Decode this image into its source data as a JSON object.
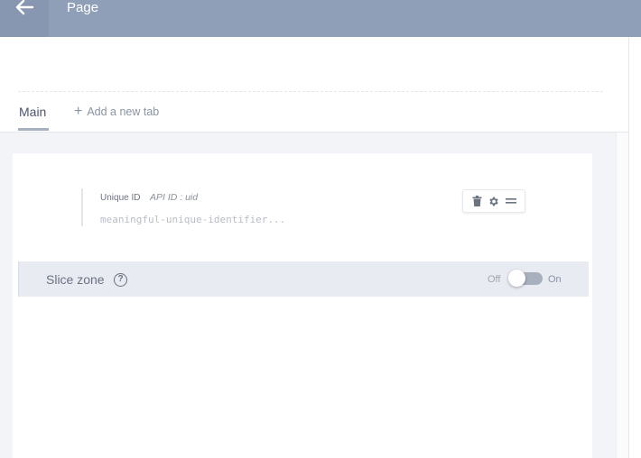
{
  "header": {
    "title": "Page",
    "back_icon": "arrow-left-icon"
  },
  "tabs": [
    {
      "label": "Main",
      "active": true
    }
  ],
  "add_tab": {
    "label": "Add a new tab",
    "icon": "plus-icon"
  },
  "uid_field": {
    "label": "Unique ID",
    "api_id": "API ID : uid",
    "placeholder": "meaningful-unique-identifier..."
  },
  "field_tools": {
    "delete_icon": "trash-icon",
    "settings_icon": "gear-icon",
    "drag_icon": "drag-handle-icon"
  },
  "slice_zone": {
    "label": "Slice zone",
    "help_icon": "question-icon",
    "off_label": "Off",
    "on_label": "On",
    "enabled": false
  },
  "colors": {
    "topbar": "#8f9fb8",
    "slice_zone_bg": "#e8ebf1",
    "canvas_bg": "#f2f4f7"
  }
}
